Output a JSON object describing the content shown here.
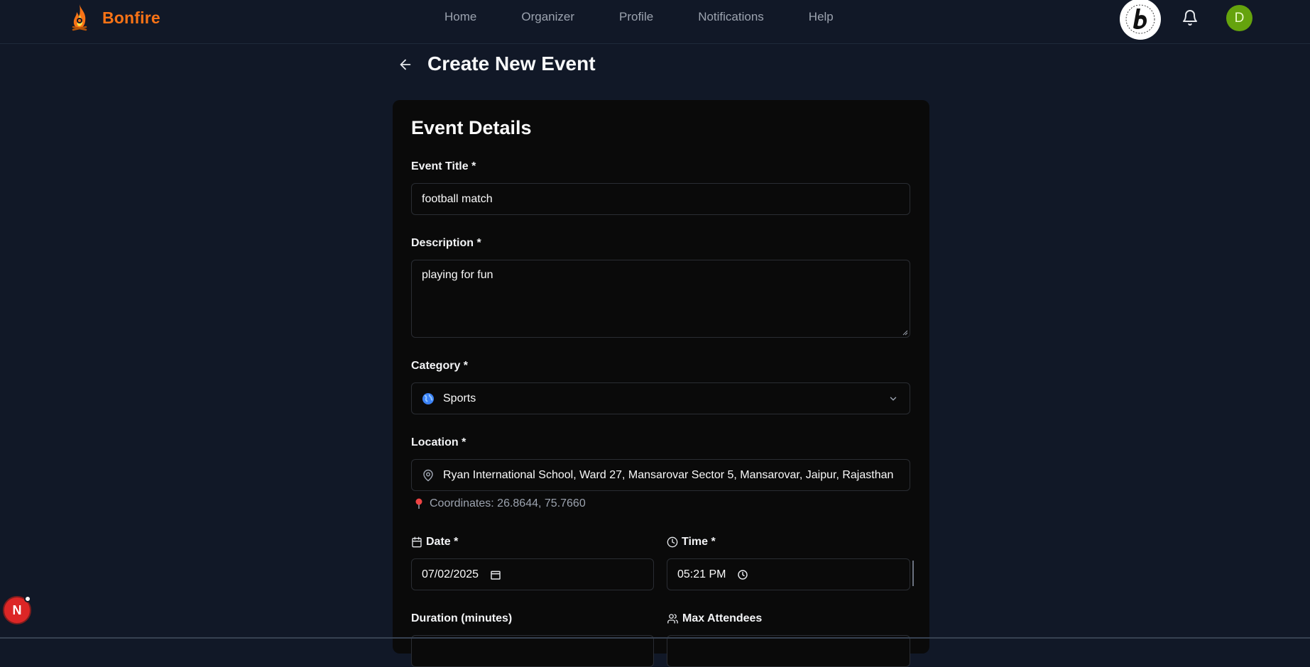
{
  "brand": {
    "name": "Bonfire",
    "accent": "#f97316"
  },
  "nav": {
    "links": [
      "Home",
      "Organizer",
      "Profile",
      "Notifications",
      "Help"
    ],
    "avatar_initial": "D"
  },
  "page": {
    "title": "Create New Event"
  },
  "form": {
    "section_title": "Event Details",
    "title_label": "Event Title *",
    "title_value": "football match",
    "description_label": "Description *",
    "description_value": "playing for fun",
    "category_label": "Category *",
    "category_value": "Sports",
    "location_label": "Location *",
    "location_value": "Ryan International School, Ward 27, Mansarovar Sector 5, Mansarovar, Jaipur, Rajasthan",
    "coordinates_text": "Coordinates: 26.8644, 75.7660",
    "date_label": "Date *",
    "date_value": "07/02/2025",
    "time_label": "Time *",
    "time_value": "05:21 PM",
    "duration_label": "Duration (minutes)",
    "max_attendees_label": "Max Attendees"
  },
  "floating": {
    "badge_letter": "N"
  }
}
